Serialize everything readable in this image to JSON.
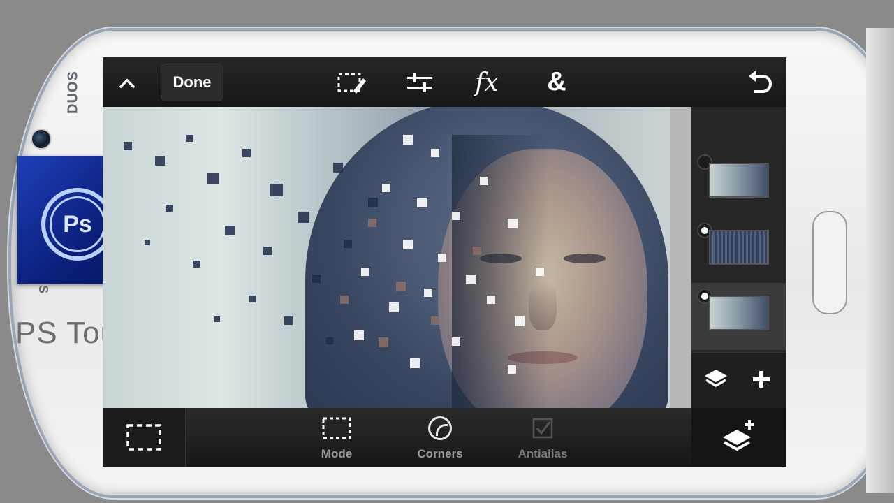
{
  "device": {
    "brand_text": "DUOS",
    "side_text": "S",
    "overlay_label": "PS Touch",
    "app_logo_text": "Ps"
  },
  "toolbar": {
    "collapse_icon": "chevron-up-icon",
    "done_label": "Done",
    "tools": [
      "selection-tool-icon",
      "adjustments-icon",
      "fx-icon",
      "blend-icon"
    ],
    "fx_glyph": "fx",
    "blend_glyph": "&",
    "undo_icon": "undo-icon"
  },
  "layers": {
    "items": [
      {
        "thumb": "dispersion-portrait",
        "visible": false,
        "active": false
      },
      {
        "thumb": "dark-texture",
        "visible": true,
        "active": false
      },
      {
        "thumb": "dispersion-portrait",
        "visible": true,
        "active": true
      }
    ],
    "ops": [
      "layers-stack-icon",
      "add-icon"
    ]
  },
  "bottom_tools": {
    "selection_icon": "marquee-icon",
    "mode_label": "Mode",
    "corners_label": "Corners",
    "antialias_label": "Antialias",
    "add_layer_icon": "add-layer-icon"
  },
  "colors": {
    "toolbar_bg": "#1e1e1e",
    "accent_logo": "#0a1f7a",
    "label_gray": "#9a9a9a"
  }
}
